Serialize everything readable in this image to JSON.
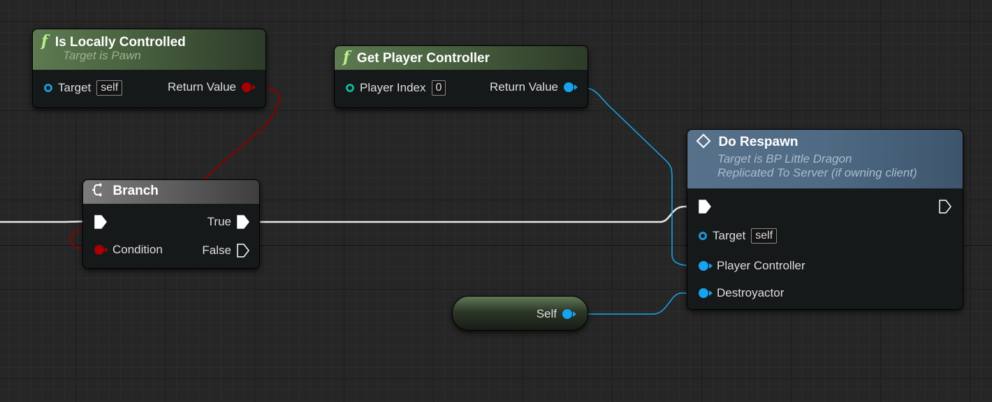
{
  "colors": {
    "exec_wire": "#ffffff",
    "object_wire": "#16a8ee",
    "bool_wire": "#8b0000",
    "pure_function_header": "#4a6340",
    "flow_header": "#5e5e5e",
    "event_header": "#4f6a84"
  },
  "nodes": {
    "is_locally_controlled": {
      "icon": "function-icon",
      "icon_glyph": "f",
      "title": "Is Locally Controlled",
      "subtitle": "Target is Pawn",
      "target_label": "Target",
      "target_default": "self",
      "return_label": "Return Value"
    },
    "get_player_controller": {
      "icon": "function-icon",
      "icon_glyph": "f",
      "title": "Get Player Controller",
      "player_index_label": "Player Index",
      "player_index_value": "0",
      "return_label": "Return Value"
    },
    "branch": {
      "icon": "branch-icon",
      "title": "Branch",
      "condition_label": "Condition",
      "true_label": "True",
      "false_label": "False"
    },
    "do_respawn": {
      "icon": "event-diamond-icon",
      "title": "Do Respawn",
      "subtitle_1": "Target is BP Little Dragon",
      "subtitle_2": "Replicated To Server (if owning client)",
      "target_label": "Target",
      "target_default": "self",
      "player_controller_label": "Player Controller",
      "destroyactor_label": "Destroyactor"
    },
    "self_ref": {
      "label": "Self"
    }
  }
}
